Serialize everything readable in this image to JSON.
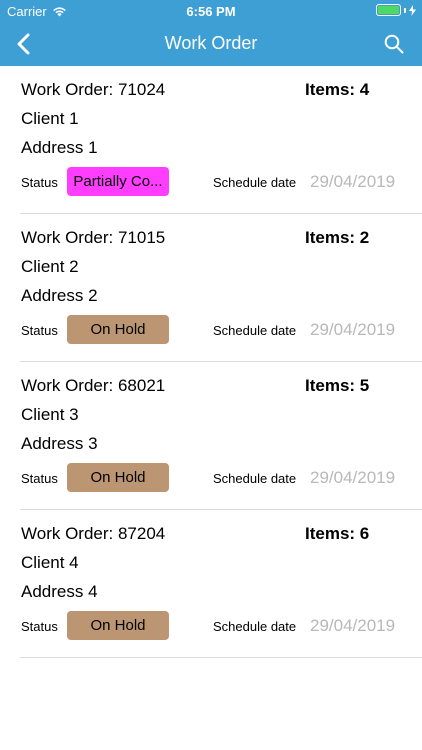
{
  "status_bar": {
    "carrier": "Carrier",
    "time": "6:56 PM",
    "battery_color": "#4cd964"
  },
  "nav": {
    "title": "Work Order",
    "back_icon": "chevron-left-icon",
    "search_icon": "search-icon",
    "bar_color": "#3d9fd4"
  },
  "orders": [
    {
      "work_order": "Work Order: 71024",
      "items": "Items: 4",
      "client": "Client 1",
      "address": "Address 1",
      "status_label": "Status",
      "status": "Partially Co...",
      "status_color": "#ff3dff",
      "schedule_label": "Schedule date",
      "schedule_date": "29/04/2019"
    },
    {
      "work_order": "Work Order: 71015",
      "items": "Items: 2",
      "client": "Client 2",
      "address": "Address 2",
      "status_label": "Status",
      "status": "On Hold",
      "status_color": "#bc9672",
      "schedule_label": "Schedule date",
      "schedule_date": "29/04/2019"
    },
    {
      "work_order": "Work Order: 68021",
      "items": "Items: 5",
      "client": "Client 3",
      "address": "Address 3",
      "status_label": "Status",
      "status": "On Hold",
      "status_color": "#bc9672",
      "schedule_label": "Schedule date",
      "schedule_date": "29/04/2019"
    },
    {
      "work_order": "Work Order: 87204",
      "items": "Items: 6",
      "client": "Client 4",
      "address": "Address 4",
      "status_label": "Status",
      "status": "On Hold",
      "status_color": "#bc9672",
      "schedule_label": "Schedule date",
      "schedule_date": "29/04/2019"
    }
  ]
}
